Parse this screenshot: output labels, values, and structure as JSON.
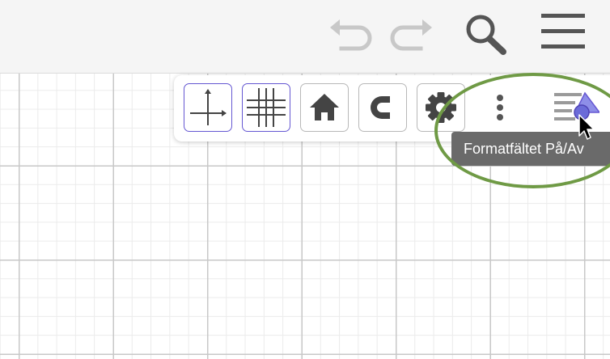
{
  "topbar": {
    "icons": [
      "undo-icon",
      "redo-icon",
      "search-icon",
      "menu-icon"
    ],
    "icon_color": "#555555",
    "disabled_color": "#c8c8c8"
  },
  "stylebar": {
    "buttons": [
      {
        "icon": "axes-icon",
        "active": true
      },
      {
        "icon": "grid-icon",
        "active": true
      },
      {
        "icon": "home-icon",
        "active": false
      },
      {
        "icon": "magnet-icon",
        "active": false
      },
      {
        "icon": "gear-icon",
        "active": false
      }
    ],
    "more_icon": "vertical-dots-icon",
    "toggle_icon": "style-bar-toggle-icon",
    "active_border_color": "#6557d2"
  },
  "tooltip": {
    "text": "Formatfältet På/Av"
  },
  "annotation": {
    "color": "#6f9a45"
  }
}
